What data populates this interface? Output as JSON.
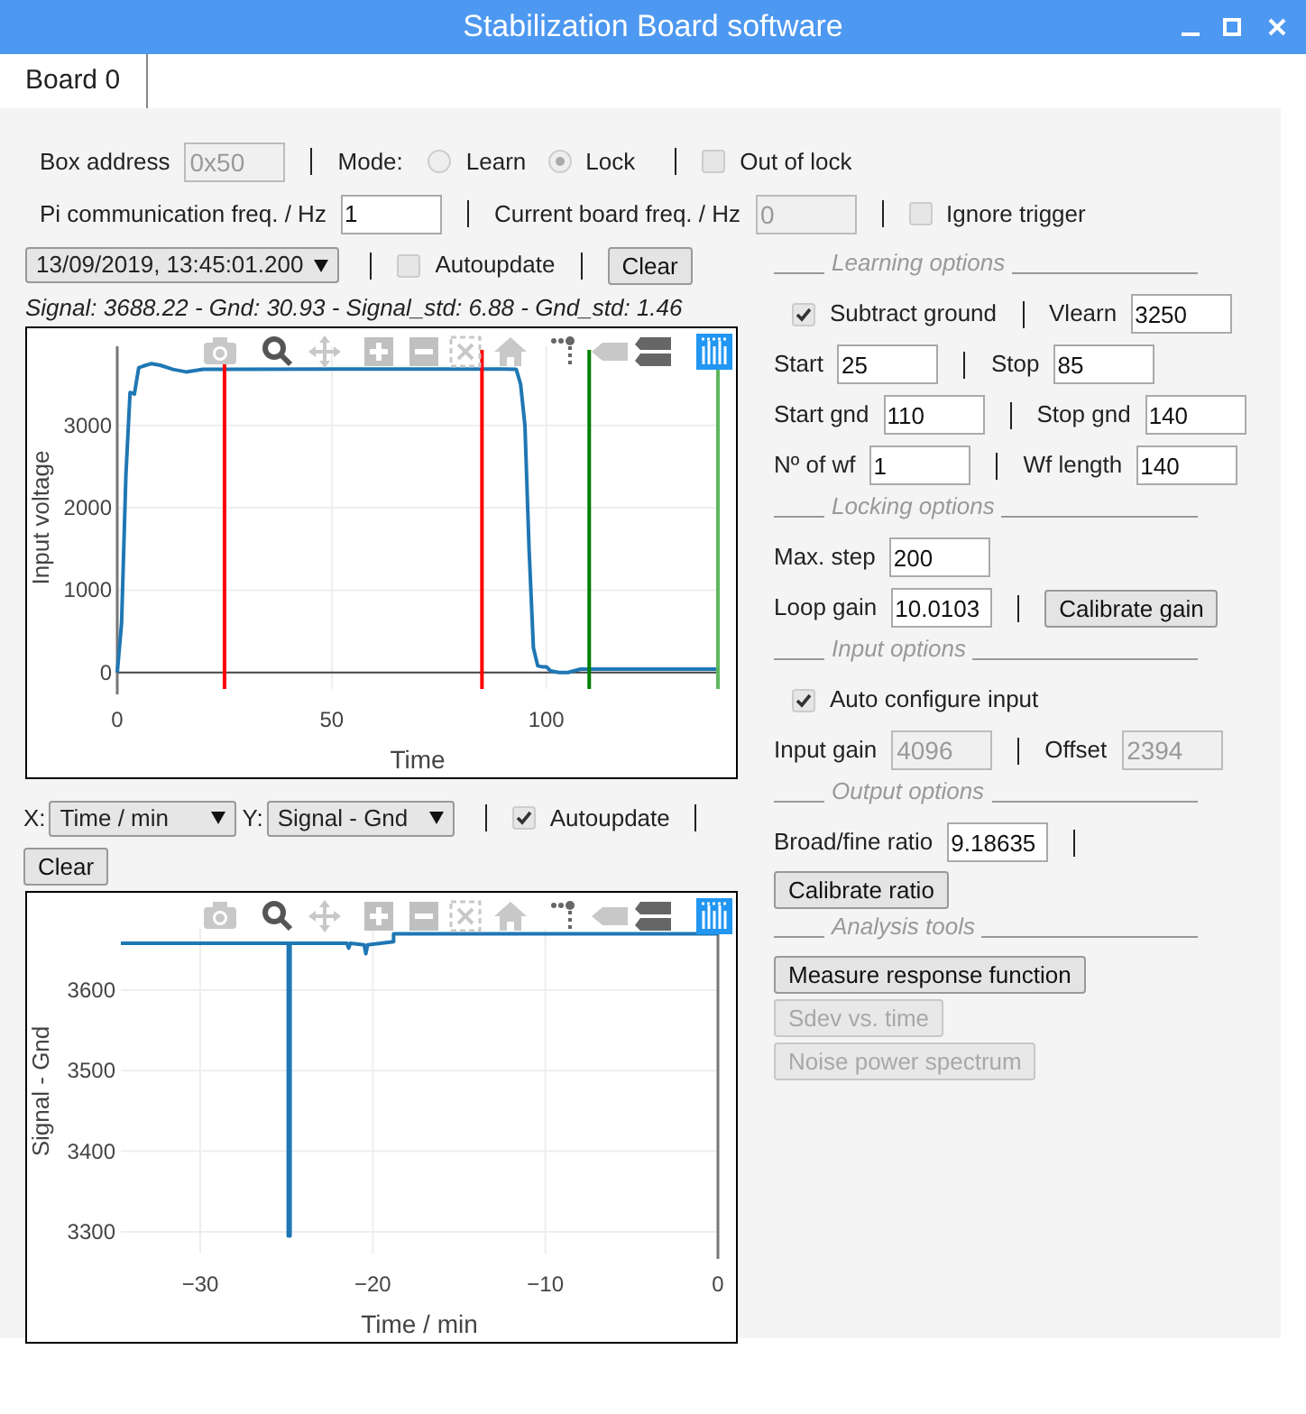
{
  "window": {
    "title": "Stabilization Board software"
  },
  "tabs": [
    {
      "label": "Board 0",
      "selected": true
    }
  ],
  "settings_rows": [
    [
      {
        "kind": "field",
        "label": "Box address",
        "value": "0x50",
        "disabled": true
      },
      {
        "kind": "separator"
      },
      {
        "kind": "text",
        "label": "Mode:"
      },
      {
        "kind": "radio",
        "label": "Learn",
        "selected": false
      },
      {
        "kind": "radio",
        "label": "Lock",
        "selected": true
      },
      {
        "kind": "separator"
      },
      {
        "kind": "checkbox",
        "label": "Out of lock",
        "checked": false
      }
    ],
    [
      {
        "kind": "field",
        "label": "Pi communication freq. / Hz",
        "value": "1",
        "disabled": false
      },
      {
        "kind": "separator"
      },
      {
        "kind": "field",
        "label": "Current board freq. / Hz",
        "value": "0",
        "disabled": true
      },
      {
        "kind": "separator"
      },
      {
        "kind": "checkbox",
        "label": "Ignore trigger",
        "checked": false
      }
    ]
  ],
  "waveform_rows": [
    [
      {
        "kind": "select",
        "value": "13/09/2019, 13:45:01.200"
      },
      {
        "kind": "separator"
      },
      {
        "kind": "checkbox",
        "label": "Autoupdate",
        "checked": false
      },
      {
        "kind": "separator"
      },
      {
        "kind": "button",
        "label": "Clear",
        "disabled": false
      }
    ]
  ],
  "stats": "Signal: 3688.22 - Gnd: 30.93 - Signal_std: 6.88 - Gnd_std: 1.46",
  "waveform_chart": {
    "chart_data": {
      "type": "line",
      "xlabel": "Time",
      "ylabel": "Input voltage",
      "x": [
        0,
        1,
        2,
        3,
        4,
        5,
        6,
        8,
        10,
        13,
        16,
        20,
        50,
        90,
        93,
        94,
        95,
        96,
        97,
        98,
        99,
        100,
        101,
        103,
        105,
        108,
        109,
        140
      ],
      "grid": true,
      "series": [
        {
          "color": "#1f77b4",
          "values": [
            0,
            600,
            2400,
            3400,
            3380,
            3700,
            3720,
            3750,
            3730,
            3680,
            3650,
            3680,
            3685,
            3685,
            3680,
            3500,
            3000,
            1500,
            300,
            80,
            70,
            70,
            20,
            0,
            0,
            40,
            40,
            40
          ]
        }
      ],
      "xlim": [
        0,
        140
      ],
      "ylim": [
        -200,
        3960
      ],
      "xticks": [
        0,
        50,
        100
      ],
      "yticks": [
        0,
        1000,
        2000,
        3000
      ],
      "ref_lines": [
        {
          "axis": "x",
          "value": 25,
          "color": "#ff0000"
        },
        {
          "axis": "x",
          "value": 85,
          "color": "#ff0000"
        },
        {
          "axis": "x",
          "value": 110,
          "color": "#008000"
        },
        {
          "axis": "x",
          "value": 140,
          "color": "#5cb85c"
        }
      ]
    }
  },
  "history_rows": [
    [
      {
        "kind": "select",
        "label": "X:",
        "value": "Time / min"
      },
      {
        "kind": "select",
        "label": "Y:",
        "value": "Signal - Gnd"
      },
      {
        "kind": "separator"
      },
      {
        "kind": "checkbox",
        "label": "Autoupdate",
        "checked": true
      },
      {
        "kind": "separator"
      }
    ],
    [
      {
        "kind": "button",
        "label": "Clear",
        "disabled": false
      }
    ]
  ],
  "history_chart": {
    "chart_data": {
      "type": "line",
      "xlabel": "Time / min",
      "ylabel": "Signal - Gnd",
      "x": [
        -34.6,
        -24.9,
        -24.9,
        -24.8,
        -24.8,
        -21.5,
        -21.4,
        -21.3,
        -20.5,
        -20.4,
        -20.3,
        -18.8,
        -18.8,
        -18.7,
        0
      ],
      "grid": true,
      "series": [
        {
          "color": "#1f77b4",
          "values": [
            3658,
            3658,
            3295,
            3295,
            3658,
            3658,
            3652,
            3658,
            3656,
            3645,
            3656,
            3660,
            3670,
            3670,
            3670
          ]
        }
      ],
      "xlim": [
        -34.6,
        0
      ],
      "ylim": [
        3273,
        3676
      ],
      "xticks": [
        {
          "value": -30,
          "label": "−30"
        },
        {
          "value": -20,
          "label": "−20"
        },
        {
          "value": -10,
          "label": "−10"
        },
        0
      ],
      "yticks": [
        3300,
        3400,
        3500,
        3600
      ]
    }
  },
  "option_sections": [
    {
      "heading": "Learning options",
      "rows": [
        [
          {
            "kind": "checkbox",
            "label": "Subtract ground",
            "checked": true
          },
          {
            "kind": "separator"
          },
          {
            "kind": "field",
            "label": "Vlearn",
            "value": "3250",
            "disabled": false
          }
        ],
        [
          {
            "kind": "field",
            "label": "Start",
            "value": "25",
            "disabled": false
          },
          {
            "kind": "separator"
          },
          {
            "kind": "field",
            "label": "Stop",
            "value": "85",
            "disabled": false
          }
        ],
        [
          {
            "kind": "field",
            "label": "Start gnd",
            "value": "110",
            "disabled": false
          },
          {
            "kind": "separator"
          },
          {
            "kind": "field",
            "label": "Stop gnd",
            "value": "140",
            "disabled": false
          }
        ],
        [
          {
            "kind": "field",
            "label": "Nº of wf",
            "value": "1",
            "disabled": false
          },
          {
            "kind": "separator"
          },
          {
            "kind": "field",
            "label": "Wf length",
            "value": "140",
            "disabled": false
          }
        ]
      ]
    },
    {
      "heading": "Locking options",
      "rows": [
        [
          {
            "kind": "field",
            "label": "Max. step",
            "value": "200",
            "disabled": false
          }
        ],
        [
          {
            "kind": "field",
            "label": "Loop gain",
            "value": "10.0103",
            "disabled": false
          },
          {
            "kind": "separator"
          },
          {
            "kind": "button",
            "label": "Calibrate gain",
            "disabled": false
          }
        ]
      ]
    },
    {
      "heading": "Input options",
      "rows": [
        [
          {
            "kind": "checkbox",
            "label": "Auto configure input",
            "checked": true
          }
        ],
        [
          {
            "kind": "field",
            "label": "Input gain",
            "value": "4096",
            "disabled": true
          },
          {
            "kind": "separator"
          },
          {
            "kind": "field",
            "label": "Offset",
            "value": "2394",
            "disabled": true
          }
        ]
      ]
    },
    {
      "heading": "Output options",
      "rows": [
        [
          {
            "kind": "field",
            "label": "Broad/fine ratio",
            "value": "9.18635",
            "disabled": false
          },
          {
            "kind": "separator"
          }
        ],
        [
          {
            "kind": "button",
            "label": "Calibrate ratio",
            "disabled": false
          }
        ]
      ]
    },
    {
      "heading": "Analysis tools",
      "rows": [
        [
          {
            "kind": "button",
            "label": "Measure response function",
            "disabled": false
          }
        ],
        [
          {
            "kind": "button",
            "label": "Sdev vs. time",
            "disabled": true
          }
        ],
        [
          {
            "kind": "button",
            "label": "Noise power spectrum",
            "disabled": true
          }
        ]
      ]
    }
  ]
}
